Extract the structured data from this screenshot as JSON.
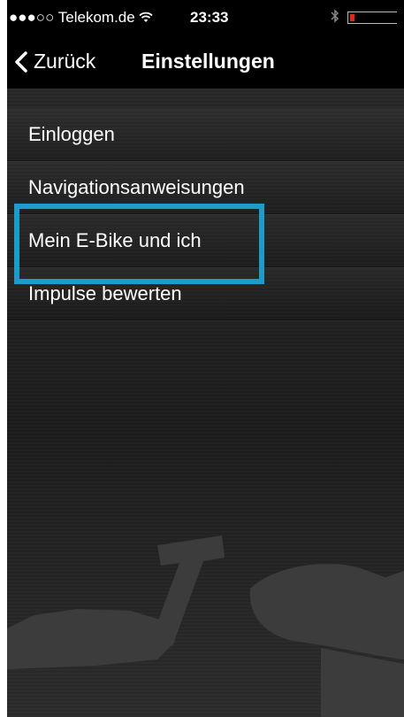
{
  "status_bar": {
    "signal": "●●●○○",
    "carrier": "Telekom.de",
    "wifi_icon": "wifi-icon",
    "time": "23:33",
    "bluetooth_icon": "bluetooth-icon",
    "battery_level_fraction": 0.1,
    "battery_color": "#e2261c"
  },
  "nav": {
    "back_label": "Zurück",
    "title": "Einstellungen"
  },
  "menu": {
    "items": [
      {
        "label": "Einloggen"
      },
      {
        "label": "Navigationsanweisungen"
      },
      {
        "label": "Mein E-Bike und ich"
      },
      {
        "label": "Impulse bewerten"
      }
    ]
  },
  "colors": {
    "highlight": "#1c9cc8",
    "background": "#222222",
    "text": "#ffffff"
  }
}
